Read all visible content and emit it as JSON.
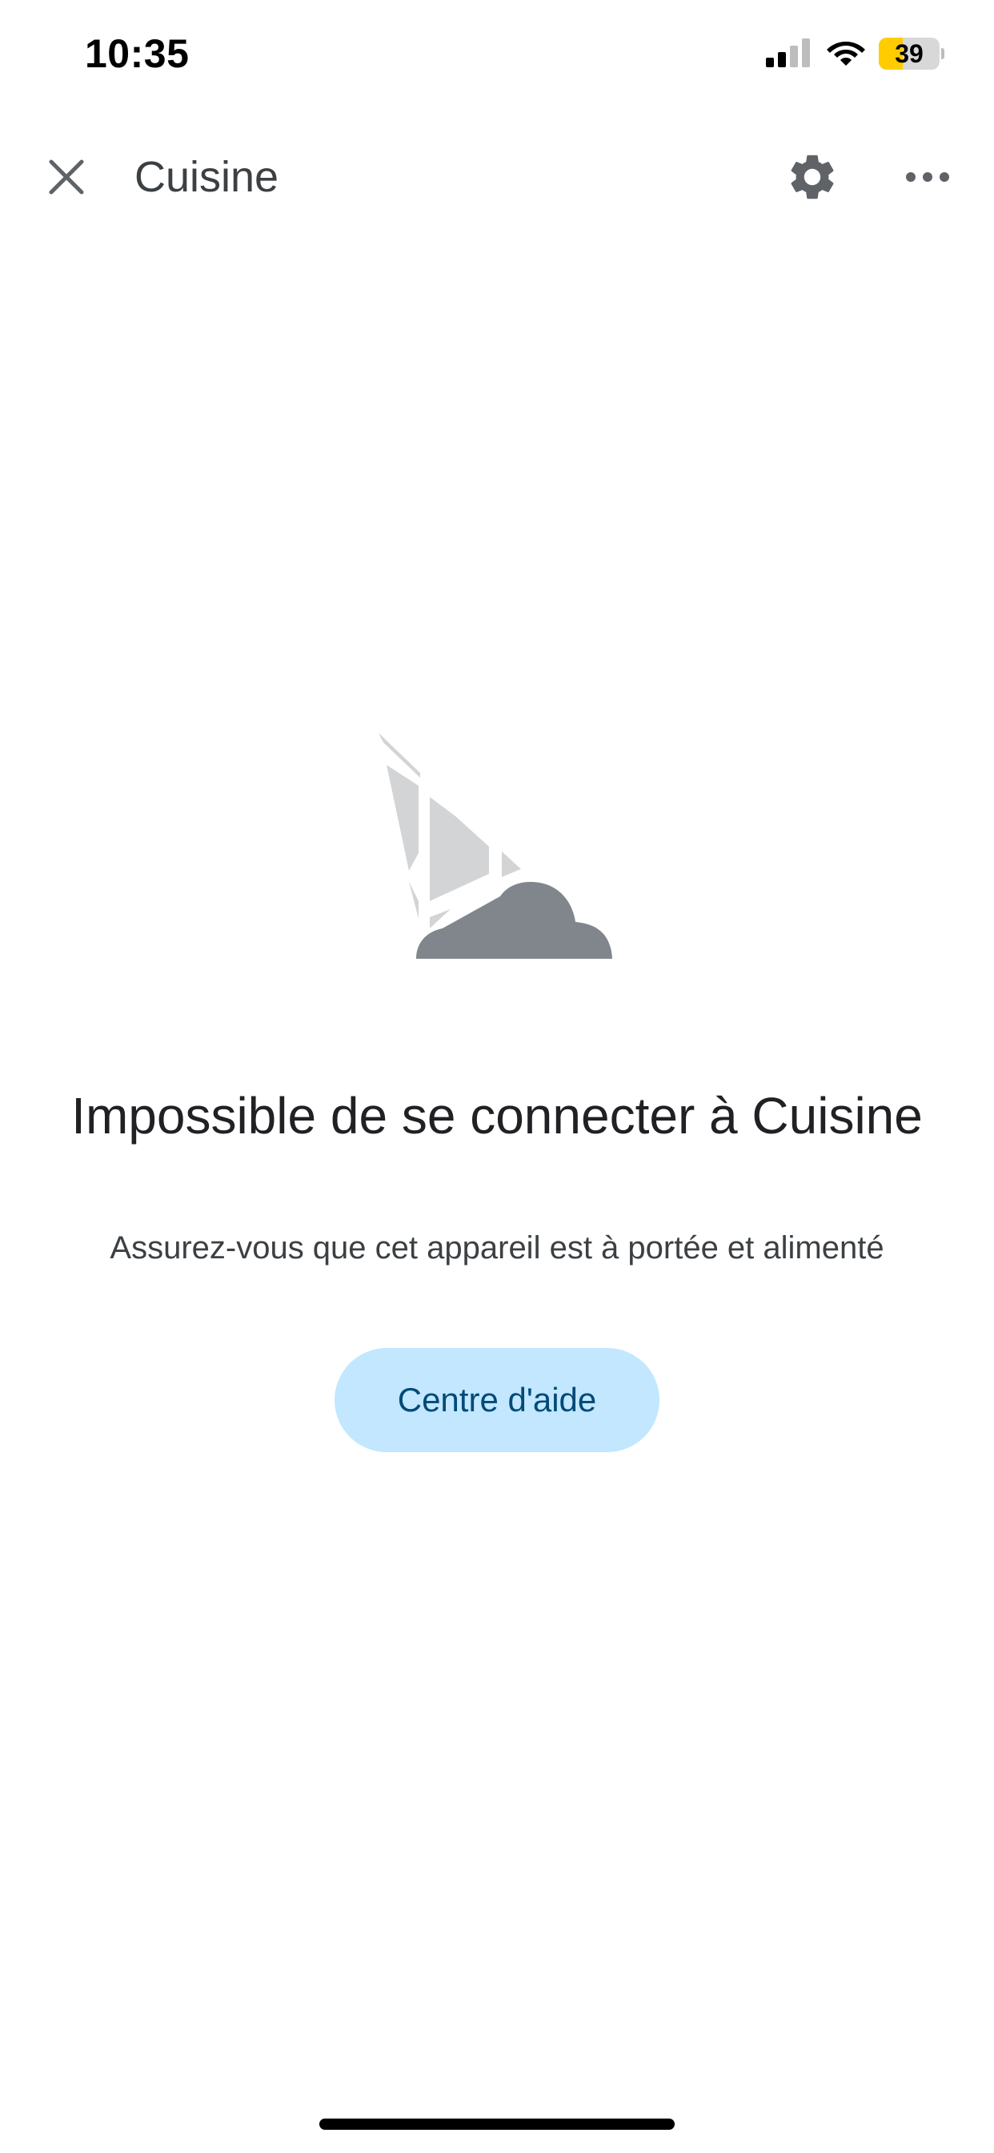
{
  "status_bar": {
    "time": "10:35",
    "battery_level": "39",
    "battery_fraction": 0.39,
    "signal_icon": "cellular-signal-icon",
    "wifi_icon": "wifi-icon"
  },
  "app_bar": {
    "title": "Cuisine",
    "close_icon": "close-icon",
    "settings_icon": "gear-icon",
    "more_icon": "more-horizontal-icon"
  },
  "illustration": {
    "icon": "disconnected-cloud-illustration"
  },
  "message": {
    "title": "Impossible de se connecter à Cuisine",
    "subtitle": "Assurez-vous que cet appareil est à portée et alimenté"
  },
  "help_button": {
    "label": "Centre d'aide"
  },
  "colors": {
    "help_button_bg": "#c2e7ff",
    "help_button_text": "#004a77",
    "battery_accent": "#ffcc00",
    "cloud": "#80868b",
    "signal_panels": "#d3d4d5"
  }
}
